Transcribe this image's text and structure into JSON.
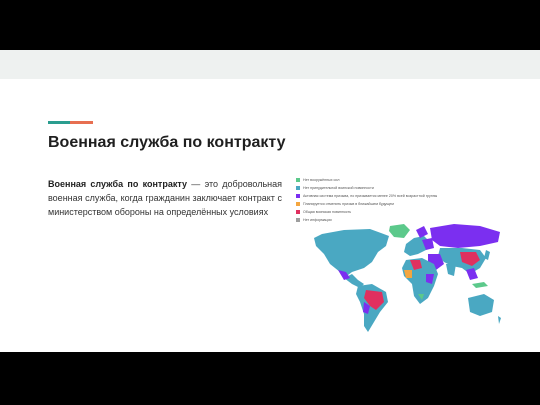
{
  "slide": {
    "title": "Военная служба по контракту",
    "term": "Военная служба по контракту",
    "definition": " — это добровольная военная служба, когда гражданин заключает контракт с министерством обороны на определённых условиях"
  },
  "map": {
    "legend": [
      {
        "label": "Нет вооружённых сил",
        "color": "#5cc98b"
      },
      {
        "label": "Нет принудительной воинской повинности",
        "color": "#4aa8c2"
      },
      {
        "label": "Активная система призыва, но призывается менее 20% всей возрастной группы",
        "color": "#7b2ff0"
      },
      {
        "label": "Планируется отменить призыв в ближайшем будущем",
        "color": "#f4a640"
      },
      {
        "label": "Общая воинская повинность",
        "color": "#e0305f"
      },
      {
        "label": "Нет информации",
        "color": "#9e9e9e"
      }
    ]
  },
  "colors": {
    "accent_teal": "#2a9d8f",
    "accent_orange": "#e76f51"
  }
}
